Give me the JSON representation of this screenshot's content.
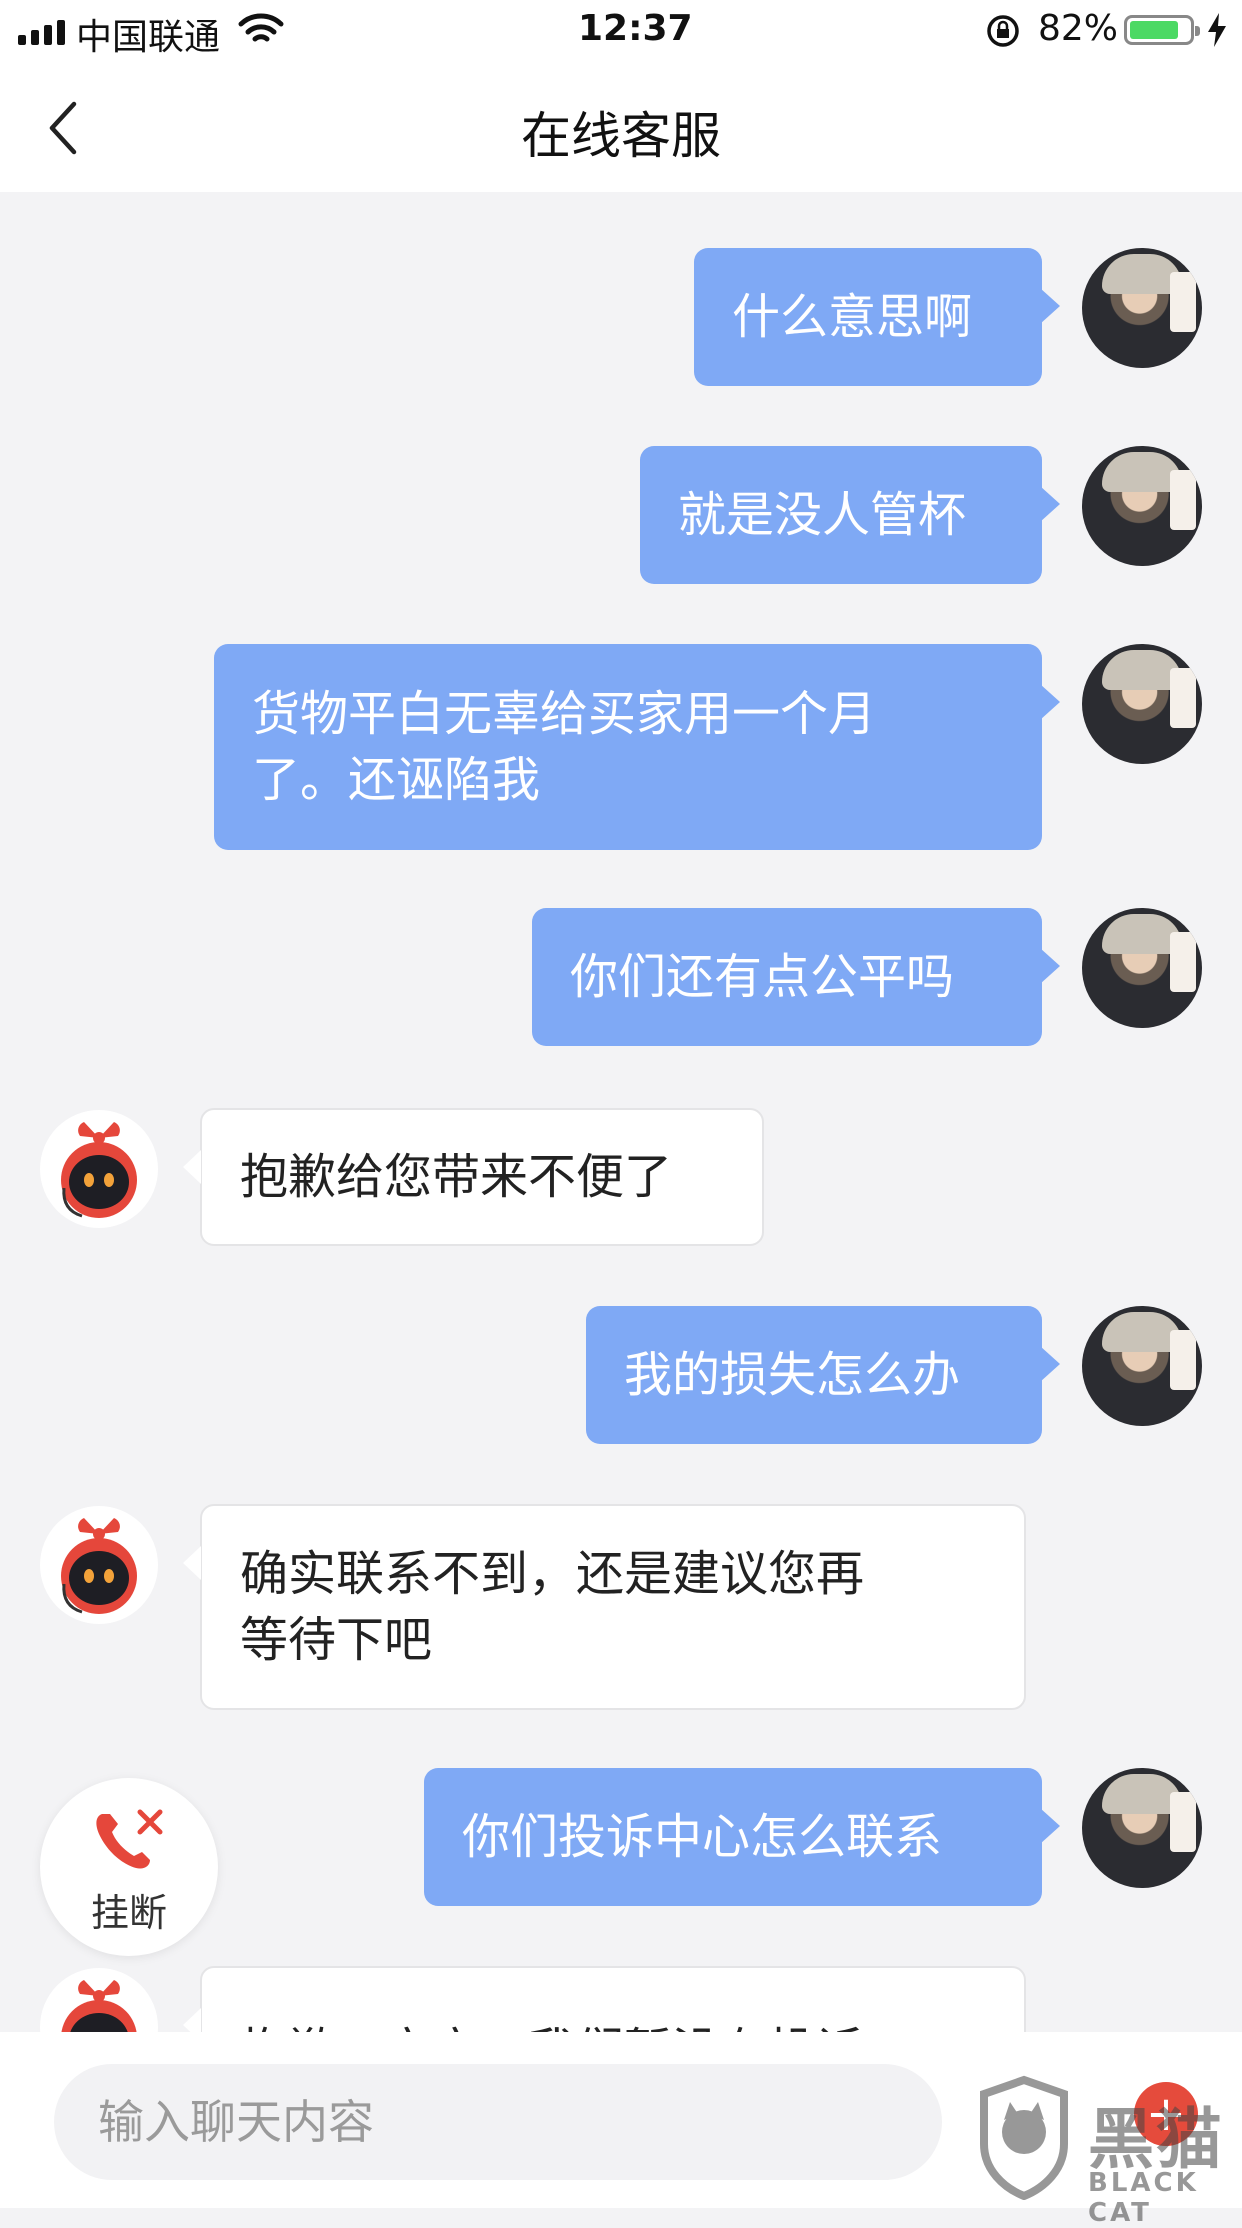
{
  "status_bar": {
    "carrier": "中国联通",
    "time": "12:37",
    "battery_percent": "82%",
    "battery_level": 0.82,
    "icons": [
      "signal-icon",
      "wifi-icon",
      "orientation-lock-icon",
      "battery-icon",
      "charging-bolt-icon"
    ]
  },
  "nav": {
    "back_icon": "chevron-left-icon",
    "title": "在线客服"
  },
  "messages": [
    {
      "sender": "user",
      "text": "什么意思啊"
    },
    {
      "sender": "user",
      "text": "就是没人管杯"
    },
    {
      "sender": "user",
      "text": "货物平白无辜给买家用一个月\n了。还诬陷我"
    },
    {
      "sender": "user",
      "text": "你们还有点公平吗"
    },
    {
      "sender": "bot",
      "text": "抱歉给您带来不便了"
    },
    {
      "sender": "user",
      "text": "我的损失怎么办"
    },
    {
      "sender": "bot",
      "text": "确实联系不到，还是建议您再\n等待下吧"
    },
    {
      "sender": "user",
      "text": "你们投诉中心怎么联系"
    },
    {
      "sender": "bot",
      "text": "抱歉，亲亲，我们暂没有投诉"
    }
  ],
  "hangup": {
    "icon": "phone-hangup-icon",
    "label": "挂断",
    "color": "#e5473b"
  },
  "input": {
    "placeholder": "输入聊天内容"
  },
  "plus_button": "+",
  "watermark": {
    "text": "黑猫",
    "sub": "BLACK CAT"
  },
  "colors": {
    "user_bubble": "#7fa9f5",
    "bot_bubble": "#ffffff",
    "background": "#f3f3f5"
  }
}
